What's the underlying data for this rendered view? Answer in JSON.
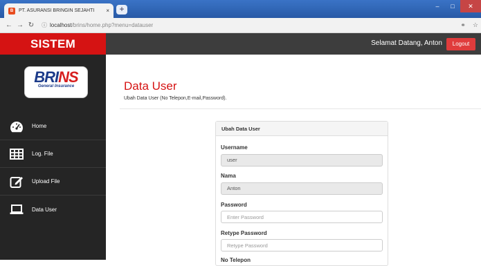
{
  "browser": {
    "tab_title": "PT. ASURANSI BRINGIN SEJAHTI",
    "tab_close": "×",
    "new_tab": "+",
    "url_host": "localhost",
    "url_path": "/brins/home.php?menu=datauser"
  },
  "header": {
    "app_title": "SISTEM",
    "welcome": "Selamat Datang, Anton",
    "logout": "Logout"
  },
  "logo": {
    "main_a": "BRI",
    "main_b": "NS",
    "sub": "General Insurance"
  },
  "sidebar": {
    "items": [
      {
        "label": "Home",
        "icon": "dashboard-icon"
      },
      {
        "label": "Log. File",
        "icon": "table-icon"
      },
      {
        "label": "Upload File",
        "icon": "edit-icon"
      },
      {
        "label": "Data User",
        "icon": "laptop-icon"
      }
    ]
  },
  "main": {
    "title": "Data User",
    "subtitle": "Ubah Data User (No Telepon,E-mail,Password).",
    "panel_title": "Ubah Data User",
    "fields": [
      {
        "label": "Username",
        "value": "user",
        "readonly": true
      },
      {
        "label": "Nama",
        "value": "Anton",
        "readonly": true
      },
      {
        "label": "Password",
        "placeholder": "Enter Password",
        "readonly": false
      },
      {
        "label": "Retype Password",
        "placeholder": "Retype Password",
        "readonly": false
      },
      {
        "label": "No Telepon"
      }
    ]
  },
  "colors": {
    "accent_red": "#d51313",
    "header_dark": "#3d3d3d",
    "sidebar_dark": "#252525"
  }
}
